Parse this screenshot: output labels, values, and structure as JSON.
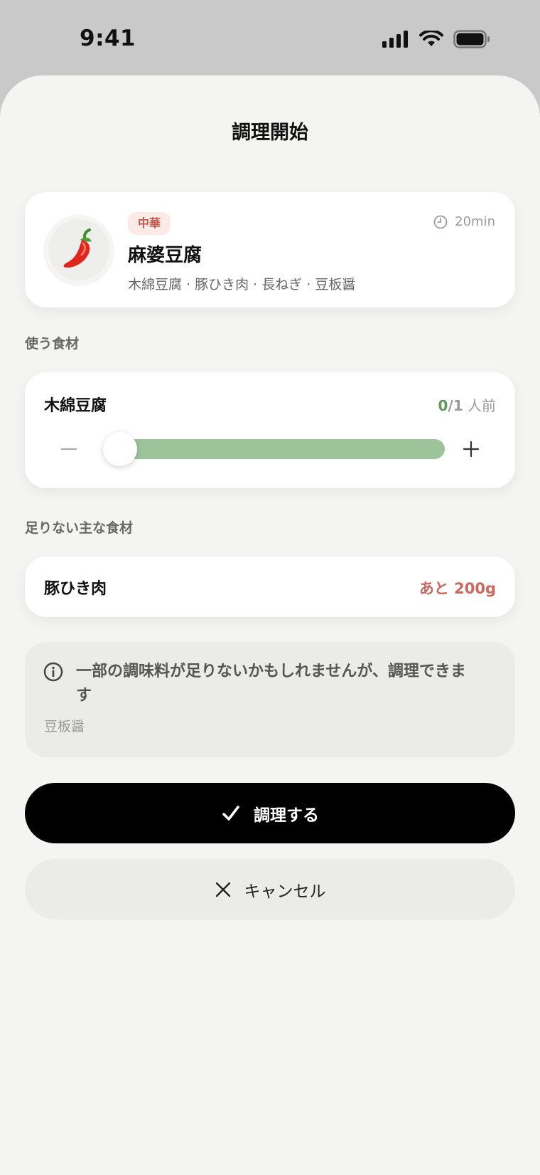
{
  "status_bar": {
    "time": "9:41"
  },
  "sheet": {
    "title": "調理開始"
  },
  "recipe": {
    "cuisine": "中華",
    "time": "20min",
    "name": "麻婆豆腐",
    "ingredients": "木綿豆腐 · 豚ひき肉 · 長ねぎ · 豆板醤",
    "icon": "chili-pepper-icon"
  },
  "use_section": {
    "label": "使う食材",
    "item": {
      "name": "木綿豆腐",
      "portion_current": "0",
      "portion_total": "/1",
      "portion_unit": " 人前",
      "slider_fraction": 0
    }
  },
  "missing_section": {
    "label": "足りない主な食材",
    "item": {
      "name": "豚ひき肉",
      "amount": "あと 200g"
    }
  },
  "note": {
    "text": "一部の調味料が足りないかもしれませんが、調理できます",
    "sub": "豆板醤"
  },
  "actions": {
    "cook_label": "調理する",
    "cancel_label": "キャンセル"
  },
  "colors": {
    "accent_green": "#9cc39a",
    "warning_red": "#c9685c",
    "primary_button": "#000000"
  }
}
